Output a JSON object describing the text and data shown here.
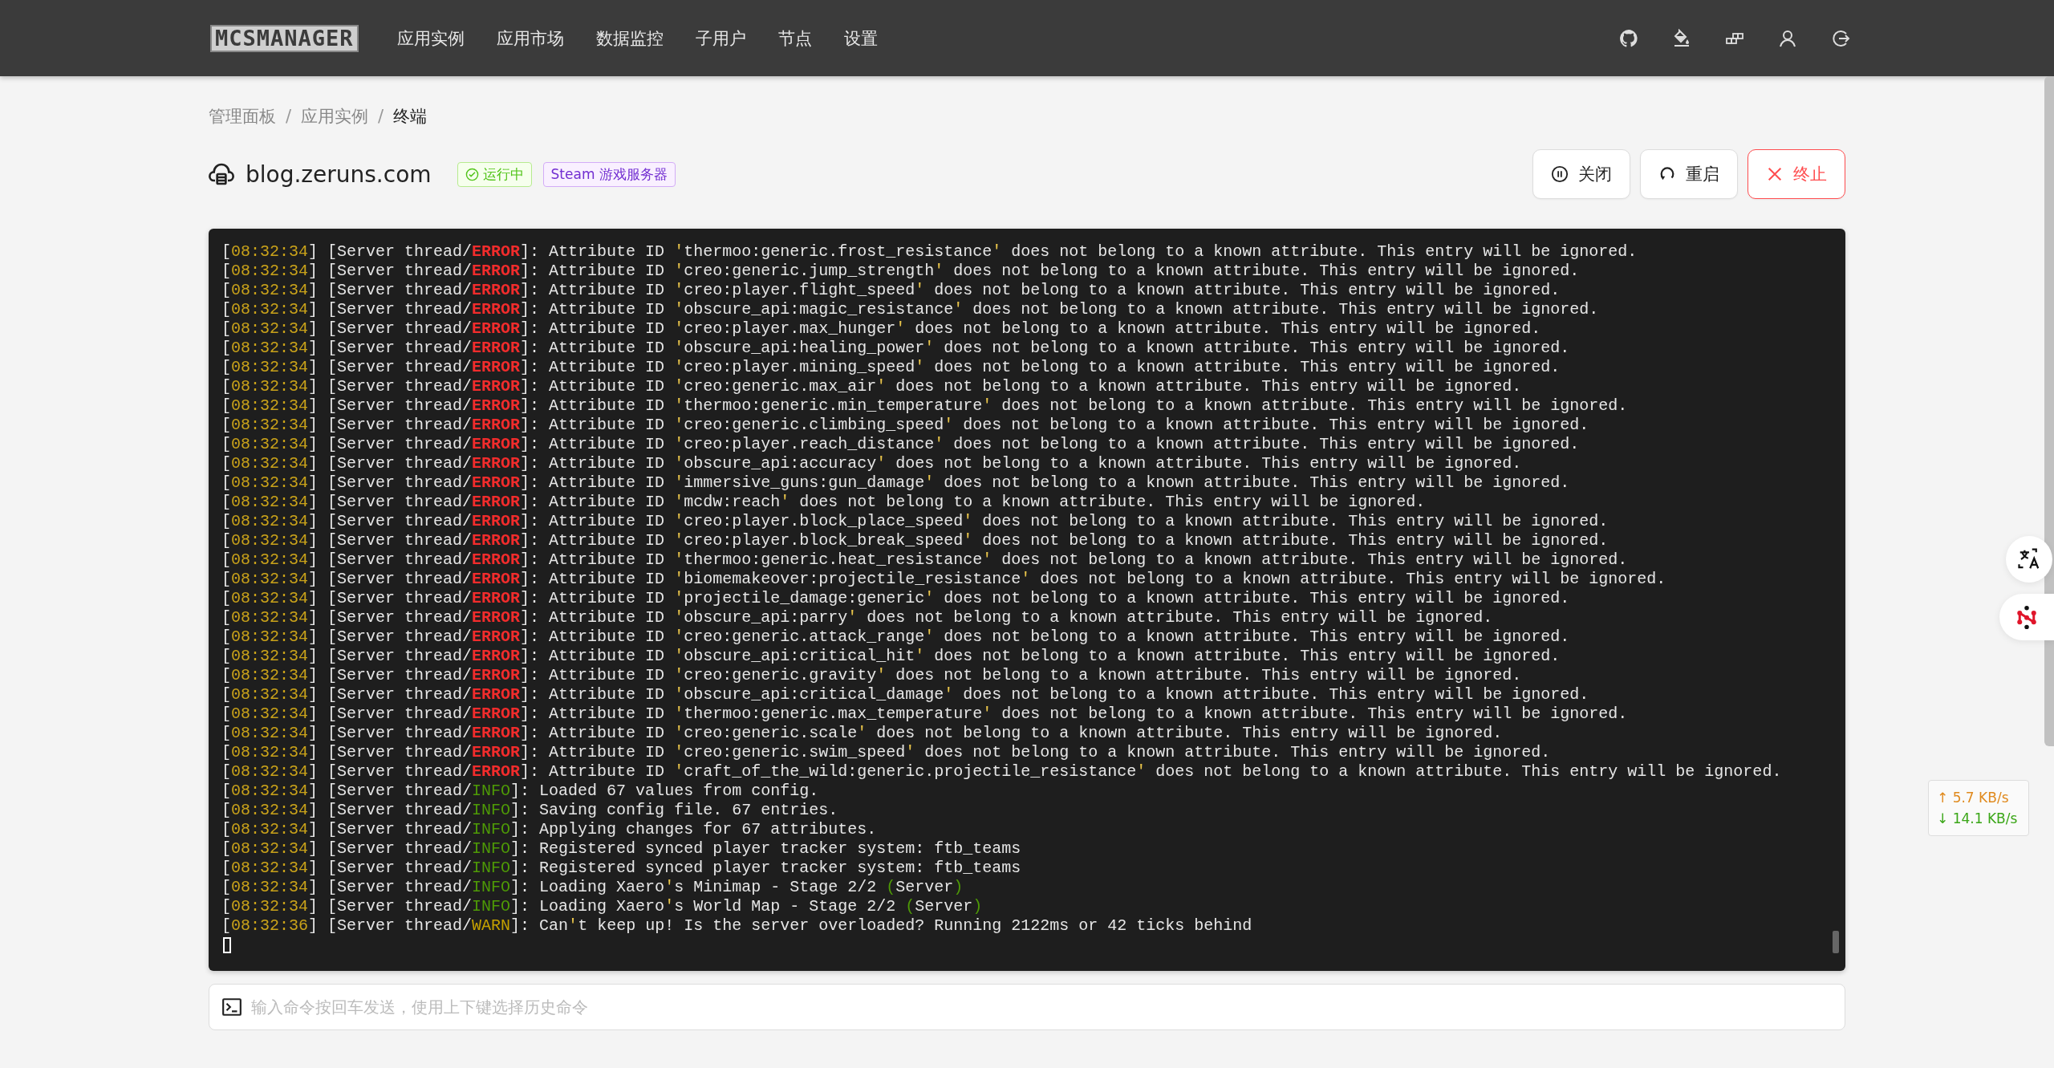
{
  "nav": {
    "logo": "MCSMANAGER",
    "items": [
      {
        "label": "应用实例",
        "selected": false
      },
      {
        "label": "应用市场",
        "selected": false
      },
      {
        "label": "数据监控",
        "selected": false
      },
      {
        "label": "子用户",
        "selected": false
      },
      {
        "label": "节点",
        "selected": false
      },
      {
        "label": "设置",
        "selected": false
      }
    ]
  },
  "breadcrumb": [
    {
      "kind": "link",
      "label": "管理面板"
    },
    {
      "kind": "separator",
      "label": "/"
    },
    {
      "kind": "link",
      "label": "应用实例"
    },
    {
      "kind": "separator",
      "label": "/"
    },
    {
      "kind": "current",
      "label": "终端"
    }
  ],
  "instance": {
    "name": "blog.zeruns.com",
    "tags": [
      {
        "kind": "status",
        "label": "运行中"
      },
      {
        "kind": "type",
        "label": "Steam 游戏服务器"
      }
    ]
  },
  "actions": [
    {
      "kind": "pause",
      "label": "关闭",
      "danger": false
    },
    {
      "kind": "restart",
      "label": "重启",
      "danger": false
    },
    {
      "kind": "kill",
      "label": "终止",
      "danger": true
    }
  ],
  "terminal": {
    "lines": [
      "[08:32:34] [Server thread/ERROR]: Attribute ID 'thermoo:generic.frost_resistance' does not belong to a known attribute. This entry will be ignored.",
      "[08:32:34] [Server thread/ERROR]: Attribute ID 'creo:generic.jump_strength' does not belong to a known attribute. This entry will be ignored.",
      "[08:32:34] [Server thread/ERROR]: Attribute ID 'creo:player.flight_speed' does not belong to a known attribute. This entry will be ignored.",
      "[08:32:34] [Server thread/ERROR]: Attribute ID 'obscure_api:magic_resistance' does not belong to a known attribute. This entry will be ignored.",
      "[08:32:34] [Server thread/ERROR]: Attribute ID 'creo:player.max_hunger' does not belong to a known attribute. This entry will be ignored.",
      "[08:32:34] [Server thread/ERROR]: Attribute ID 'obscure_api:healing_power' does not belong to a known attribute. This entry will be ignored.",
      "[08:32:34] [Server thread/ERROR]: Attribute ID 'creo:player.mining_speed' does not belong to a known attribute. This entry will be ignored.",
      "[08:32:34] [Server thread/ERROR]: Attribute ID 'creo:generic.max_air' does not belong to a known attribute. This entry will be ignored.",
      "[08:32:34] [Server thread/ERROR]: Attribute ID 'thermoo:generic.min_temperature' does not belong to a known attribute. This entry will be ignored.",
      "[08:32:34] [Server thread/ERROR]: Attribute ID 'creo:generic.climbing_speed' does not belong to a known attribute. This entry will be ignored.",
      "[08:32:34] [Server thread/ERROR]: Attribute ID 'creo:player.reach_distance' does not belong to a known attribute. This entry will be ignored.",
      "[08:32:34] [Server thread/ERROR]: Attribute ID 'obscure_api:accuracy' does not belong to a known attribute. This entry will be ignored.",
      "[08:32:34] [Server thread/ERROR]: Attribute ID 'immersive_guns:gun_damage' does not belong to a known attribute. This entry will be ignored.",
      "[08:32:34] [Server thread/ERROR]: Attribute ID 'mcdw:reach' does not belong to a known attribute. This entry will be ignored.",
      "[08:32:34] [Server thread/ERROR]: Attribute ID 'creo:player.block_place_speed' does not belong to a known attribute. This entry will be ignored.",
      "[08:32:34] [Server thread/ERROR]: Attribute ID 'creo:player.block_break_speed' does not belong to a known attribute. This entry will be ignored.",
      "[08:32:34] [Server thread/ERROR]: Attribute ID 'thermoo:generic.heat_resistance' does not belong to a known attribute. This entry will be ignored.",
      "[08:32:34] [Server thread/ERROR]: Attribute ID 'biomemakeover:projectile_resistance' does not belong to a known attribute. This entry will be ignored.",
      "[08:32:34] [Server thread/ERROR]: Attribute ID 'projectile_damage:generic' does not belong to a known attribute. This entry will be ignored.",
      "[08:32:34] [Server thread/ERROR]: Attribute ID 'obscure_api:parry' does not belong to a known attribute. This entry will be ignored.",
      "[08:32:34] [Server thread/ERROR]: Attribute ID 'creo:generic.attack_range' does not belong to a known attribute. This entry will be ignored.",
      "[08:32:34] [Server thread/ERROR]: Attribute ID 'obscure_api:critical_hit' does not belong to a known attribute. This entry will be ignored.",
      "[08:32:34] [Server thread/ERROR]: Attribute ID 'creo:generic.gravity' does not belong to a known attribute. This entry will be ignored.",
      "[08:32:34] [Server thread/ERROR]: Attribute ID 'obscure_api:critical_damage' does not belong to a known attribute. This entry will be ignored.",
      "[08:32:34] [Server thread/ERROR]: Attribute ID 'thermoo:generic.max_temperature' does not belong to a known attribute. This entry will be ignored.",
      "[08:32:34] [Server thread/ERROR]: Attribute ID 'creo:generic.scale' does not belong to a known attribute. This entry will be ignored.",
      "[08:32:34] [Server thread/ERROR]: Attribute ID 'creo:generic.swim_speed' does not belong to a known attribute. This entry will be ignored.",
      "[08:32:34] [Server thread/ERROR]: Attribute ID 'craft_of_the_wild:generic.projectile_resistance' does not belong to a known attribute. This entry will be ignored.",
      "[08:32:34] [Server thread/INFO]: Loaded 67 values from config.",
      "[08:32:34] [Server thread/INFO]: Saving config file. 67 entries.",
      "[08:32:34] [Server thread/INFO]: Applying changes for 67 attributes.",
      "[08:32:34] [Server thread/INFO]: Registered synced player tracker system: ftb_teams",
      "[08:32:34] [Server thread/INFO]: Registered synced player tracker system: ftb_teams",
      "[08:32:34] [Server thread/INFO]: Loading Xaero's Minimap - Stage 2/2 (Server)",
      "[08:32:34] [Server thread/INFO]: Loading Xaero's World Map - Stage 2/2 (Server)",
      "[08:32:36] [Server thread/WARN]: Can't keep up! Is the server overloaded? Running 2122ms or 42 ticks behind"
    ]
  },
  "command": {
    "placeholder": "输入命令按回车发送，使用上下键选择历史命令"
  },
  "net_speed": [
    {
      "arrow": "↑",
      "value": "5.7 KB/s",
      "color": "#e08a1e"
    },
    {
      "arrow": "↓",
      "value": "14.1 KB/s",
      "color": "#3aa617"
    }
  ]
}
